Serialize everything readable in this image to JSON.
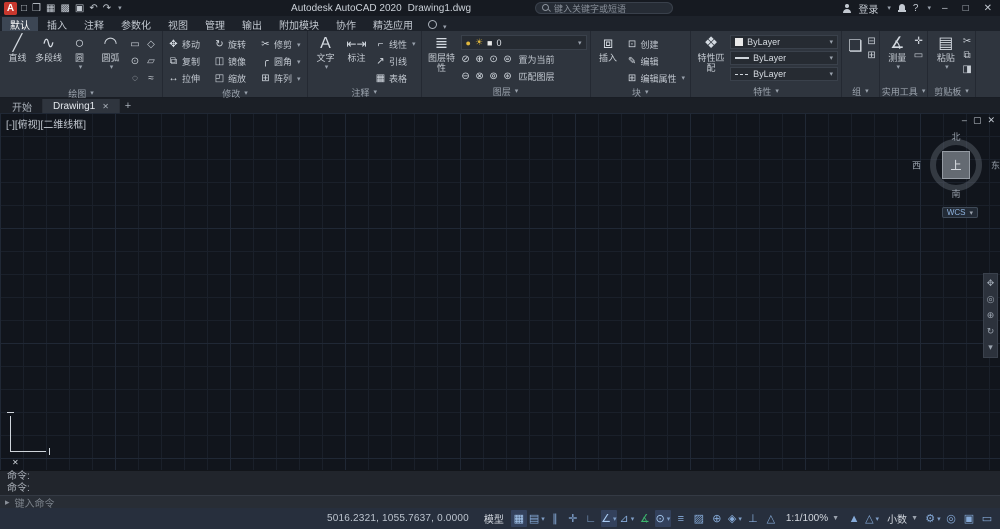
{
  "colors": {
    "logo_red": "#c8382e",
    "icon_blue": "#86abd9",
    "active_bg": "#33415c",
    "green": "#3cb56d",
    "yellow": "#e0b73c",
    "bylayer_swatch": "#e9e9e9",
    "statusbar_bg": "#272f3d"
  },
  "ui": {
    "caret": "▾",
    "caret_solid": "▼"
  },
  "titlebar": {
    "logo": "A",
    "quick_icons": [
      {
        "name": "new-file",
        "glyph": "□"
      },
      {
        "name": "open-file",
        "glyph": "❒"
      },
      {
        "name": "save",
        "glyph": "▦"
      },
      {
        "name": "save-as",
        "glyph": "▩"
      },
      {
        "name": "plot",
        "glyph": "▣"
      },
      {
        "name": "undo",
        "glyph": "↶"
      },
      {
        "name": "redo",
        "glyph": "↷"
      }
    ],
    "app_title": "Autodesk AutoCAD 2020",
    "doc_title": "Drawing1.dwg",
    "search_placeholder": "键入关键字或短语",
    "login_label": "登录",
    "help_label": "?",
    "window": {
      "minimize": "–",
      "maximize": "□",
      "close": "✕"
    }
  },
  "menu_tabs": {
    "items": [
      "默认",
      "插入",
      "注释",
      "参数化",
      "视图",
      "管理",
      "输出",
      "附加模块",
      "协作",
      "精选应用"
    ]
  },
  "ribbon": {
    "draw": {
      "label": "绘图",
      "buttons": [
        {
          "label": "直线",
          "glyph": "╱"
        },
        {
          "label": "多段线",
          "glyph": "∿"
        },
        {
          "label": "圆",
          "glyph": "○"
        },
        {
          "label": "圆弧",
          "glyph": "◠"
        }
      ],
      "extra_icons": [
        {
          "glyph": "▭"
        },
        {
          "glyph": "◇"
        },
        {
          "glyph": "⊙"
        },
        {
          "glyph": "▱"
        },
        {
          "glyph": "◌"
        },
        {
          "glyph": "≈"
        }
      ]
    },
    "modify": {
      "label": "修改",
      "buttons": [
        {
          "label": "移动",
          "glyph": "✥"
        },
        {
          "label": "旋转",
          "glyph": "↻"
        },
        {
          "label": "修剪",
          "glyph": "✂"
        },
        {
          "label": "复制",
          "glyph": "⧉"
        },
        {
          "label": "镜像",
          "glyph": "◫"
        },
        {
          "label": "圆角",
          "glyph": "╭"
        },
        {
          "label": "拉伸",
          "glyph": "↔"
        },
        {
          "label": "缩放",
          "glyph": "◰"
        },
        {
          "label": "阵列",
          "glyph": "⊞"
        }
      ]
    },
    "annotate": {
      "label": "注释",
      "text_button": {
        "label": "文字",
        "glyph": "A"
      },
      "dim_button": {
        "label": "标注",
        "glyph": "⇤⇥"
      },
      "small_buttons": [
        {
          "label": "线性",
          "glyph": "⌐"
        },
        {
          "label": "引线",
          "glyph": "↗"
        },
        {
          "label": "表格",
          "glyph": "▦"
        }
      ]
    },
    "layers": {
      "label": "图层",
      "properties_button": {
        "label": "图层特性",
        "glyph": "≣"
      },
      "dropdown": {
        "value": "0",
        "status_icons": [
          {
            "name": "layer-on-bulb",
            "glyph": "●"
          },
          {
            "name": "layer-freeze-sun",
            "glyph": "☀"
          },
          {
            "name": "layer-color-swatch",
            "glyph": "■"
          }
        ]
      },
      "row1_icons": [
        "⊘",
        "⊕",
        "⊙",
        "⊜"
      ],
      "row1_button": "置为当前",
      "row2_icons": [
        "⊖",
        "⊗",
        "⊚",
        "⊛"
      ],
      "row2_button": "匹配图层"
    },
    "block": {
      "label": "块",
      "insert_button": {
        "label": "插入",
        "glyph": "⧈"
      },
      "small_buttons": [
        {
          "label": "创建",
          "glyph": "⊡"
        },
        {
          "label": "编辑",
          "glyph": "✎"
        },
        {
          "label": "编辑属性",
          "glyph": "⊞"
        }
      ]
    },
    "properties": {
      "label": "特性",
      "match_button": {
        "label": "特性匹配",
        "glyph": "❖"
      },
      "rows": [
        {
          "name": "object-color",
          "text": "ByLayer"
        },
        {
          "name": "lineweight",
          "text": "ByLayer"
        },
        {
          "name": "linetype",
          "text": "ByLayer"
        }
      ]
    },
    "groups": {
      "label": "组",
      "icons": [
        {
          "glyph": "❏"
        },
        {
          "glyph": "⊟"
        },
        {
          "glyph": "⊞"
        }
      ]
    },
    "utilities": {
      "label": "实用工具",
      "measure_button": {
        "label": "测量",
        "glyph": "∡"
      },
      "small_icons": [
        {
          "glyph": "✛"
        },
        {
          "glyph": "▭"
        }
      ]
    },
    "clipboard": {
      "label": "剪贴板",
      "paste_button": {
        "label": "粘贴",
        "glyph": "▤"
      },
      "small_icons": [
        {
          "glyph": "✂"
        },
        {
          "glyph": "⧉"
        },
        {
          "glyph": "◨"
        }
      ]
    }
  },
  "file_tabs": {
    "start": "开始",
    "document": "Drawing1",
    "close": "✕",
    "add": "+"
  },
  "viewport": {
    "view_controls": "[-][俯视][二维线框]",
    "window": {
      "minimize": "–",
      "restore": "▢",
      "close": "✕"
    },
    "viewcube": {
      "north": "北",
      "south": "南",
      "west": "西",
      "east": "东",
      "top": "上",
      "wcs": "WCS"
    },
    "navbar_icons": [
      {
        "glyph": "✥"
      },
      {
        "glyph": "◎"
      },
      {
        "glyph": "⊕"
      },
      {
        "glyph": "↻"
      },
      {
        "glyph": "▾"
      }
    ],
    "cursor_mark": "✕"
  },
  "command": {
    "history": [
      "命令:",
      "命令:"
    ],
    "prompt_glyph": "▸",
    "placeholder": "键入命令"
  },
  "statusbar": {
    "coords": "5016.2321, 1055.7637, 0.0000",
    "model_label": "模型",
    "scale_label": "1:1/100%",
    "units_label": "小数",
    "toggles": [
      {
        "name": "grid",
        "glyph": "▦",
        "state": "on"
      },
      {
        "name": "snap-mode",
        "glyph": "▤",
        "caret": true
      },
      {
        "name": "infer-constraints",
        "glyph": "∥"
      },
      {
        "name": "dynamic-input",
        "glyph": "✛"
      },
      {
        "name": "ortho-mode",
        "glyph": "∟"
      },
      {
        "name": "polar-tracking",
        "glyph": "∠",
        "caret": true,
        "state": "on"
      },
      {
        "name": "isodraft",
        "glyph": "⊿",
        "caret": true
      },
      {
        "name": "autosnap",
        "glyph": "∡",
        "state": "green"
      },
      {
        "name": "object-snap",
        "glyph": "⊙",
        "caret": true,
        "state": "on"
      },
      {
        "name": "lineweight",
        "glyph": "≡"
      },
      {
        "name": "transparency",
        "glyph": "▨"
      },
      {
        "name": "selection-cycling",
        "glyph": "⊕"
      },
      {
        "name": "osnap-3d",
        "glyph": "◈",
        "caret": true
      },
      {
        "name": "dynamic-ucs",
        "glyph": "⊥"
      },
      {
        "name": "annotation-monitor",
        "glyph": "△"
      }
    ],
    "mid_icons": [
      {
        "name": "annotation-visibility",
        "glyph": "▲"
      },
      {
        "name": "autoscale",
        "glyph": "△",
        "caret": true
      }
    ],
    "right_icons": [
      {
        "name": "workspace-gear",
        "glyph": "⚙",
        "caret": true
      },
      {
        "name": "isolate-objects",
        "glyph": "◎"
      },
      {
        "name": "graphics-performance",
        "glyph": "▣"
      },
      {
        "name": "clean-screen",
        "glyph": "▭"
      }
    ]
  }
}
